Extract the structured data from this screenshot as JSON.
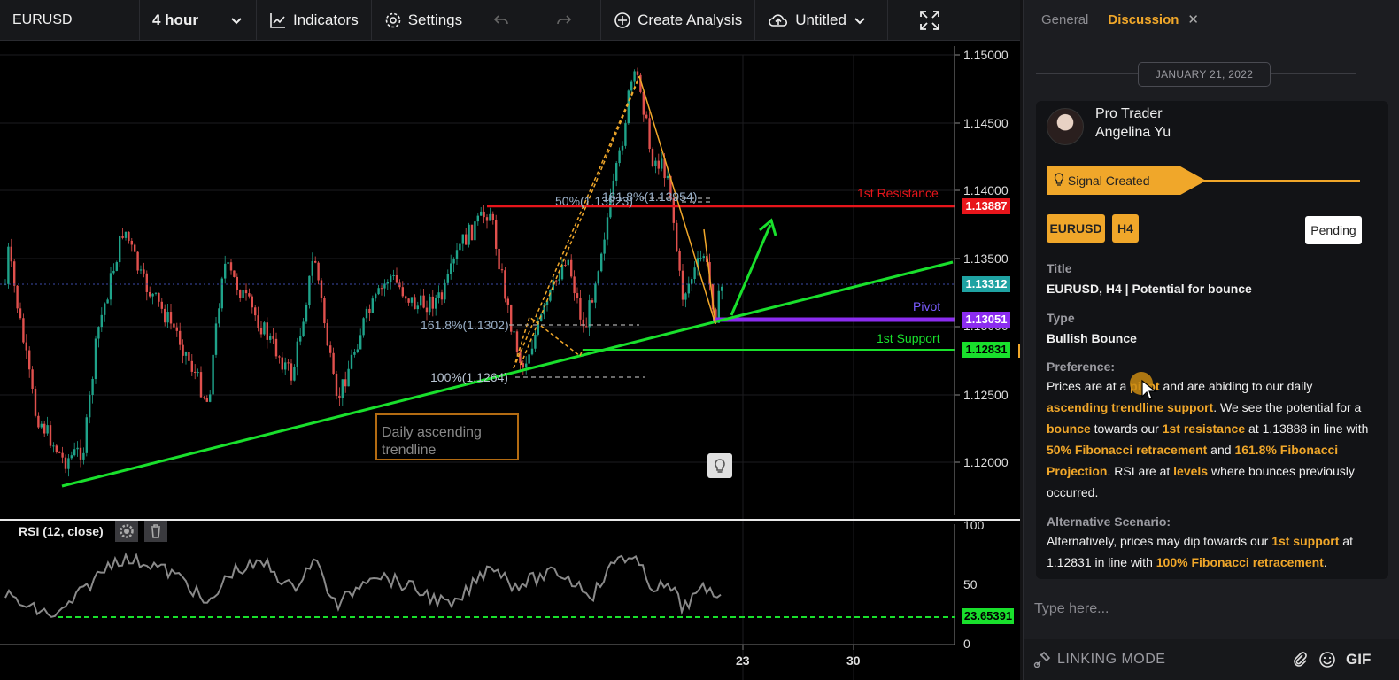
{
  "toolbar": {
    "symbol": "EURUSD",
    "timeframe": "4 hour",
    "indicators_label": "Indicators",
    "settings_label": "Settings",
    "create_label": "Create Analysis",
    "save_label": "Untitled"
  },
  "chart": {
    "price_ticks": [
      "1.15000",
      "1.14500",
      "1.14000",
      "1.13500",
      "1.13000",
      "1.12500",
      "1.12000"
    ],
    "price_tags": {
      "resistance": "1.13887",
      "current": "1.13312",
      "pivot": "1.13051",
      "support": "1.12831"
    },
    "labels": {
      "resistance": "1st Resistance",
      "pivot": "Pivot",
      "support": "1st Support",
      "fib_50": "50%(1.13923)",
      "fib_1618_top": "161.8%(1.13954)",
      "fib_1618_mid": "161.8%(1.1302)",
      "fib_100": "100%(1.1264)",
      "trendline_note": "Daily ascending trendline"
    },
    "date_ticks": [
      "23",
      "30"
    ],
    "colors": {
      "resistance": "#e8151b",
      "support": "#19e02c",
      "pivot": "#8b2cf0",
      "current": "#1fa3a3",
      "fib": "#f0a72a"
    }
  },
  "rsi": {
    "title": "RSI (12, close)",
    "ticks": [
      "100",
      "50",
      "0"
    ],
    "value": "23.65391"
  },
  "panel": {
    "tabs": [
      {
        "label": "General"
      },
      {
        "label": "Discussion"
      }
    ],
    "date": "JANUARY 21, 2022",
    "user_role": "Pro Trader",
    "user_name": "Angelina Yu",
    "signal": "Signal Created",
    "chip_symbol": "EURUSD",
    "chip_tf": "H4",
    "status": "Pending",
    "title_label": "Title",
    "title_value": "EURUSD, H4 | Potential for bounce",
    "type_label": "Type",
    "type_value": "Bullish Bounce",
    "pref_label": "Preference:",
    "pref_parts": {
      "p1": "Prices are at a ",
      "h1": "pivot",
      "p2": " and are abiding to our daily ",
      "h2": "ascending trendline support",
      "p3": ". We see the potential for a ",
      "h3": "bounce",
      "p4": " towards our ",
      "h4": "1st resistance",
      "p5": " at 1.13888 in line with ",
      "h5": "50% Fibonacci retracement",
      "p6": " and ",
      "h6": "161.8% Fibonacci Projection",
      "p7": ". RSI are at ",
      "h7": "levels",
      "p8": " where bounces previously occurred."
    },
    "alt_label": "Alternative Scenario:",
    "alt_parts": {
      "p1": "Alternatively, prices may dip towards our ",
      "h1": "1st support",
      "p2": " at 1.12831 in line with ",
      "h2": "100% Fibonacci retracement",
      "p3": "."
    },
    "input_placeholder": "Type here...",
    "linking_mode": "LINKING MODE",
    "gif": "GIF"
  }
}
